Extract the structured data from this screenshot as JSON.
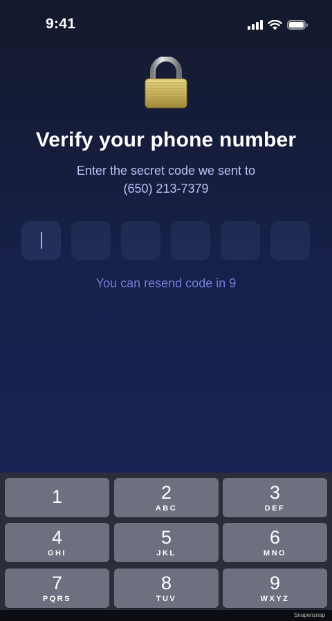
{
  "status_bar": {
    "time": "9:41",
    "icons": [
      "cellular-signal-icon",
      "wifi-icon",
      "battery-icon"
    ]
  },
  "header": {
    "icon": "padlock-icon",
    "title": "Verify your phone number",
    "subtitle_line1": "Enter the secret code we sent to",
    "phone_number": "(650) 213-7379"
  },
  "code_input": {
    "length": 6,
    "digits": [
      "",
      "",
      "",
      "",
      "",
      ""
    ],
    "active_index": 0
  },
  "resend": {
    "text": "You can resend code in 9"
  },
  "keypad": {
    "keys": [
      {
        "digit": "1",
        "letters": ""
      },
      {
        "digit": "2",
        "letters": "ABC"
      },
      {
        "digit": "3",
        "letters": "DEF"
      },
      {
        "digit": "4",
        "letters": "GHI"
      },
      {
        "digit": "5",
        "letters": "JKL"
      },
      {
        "digit": "6",
        "letters": "MNO"
      },
      {
        "digit": "7",
        "letters": "PQRS"
      },
      {
        "digit": "8",
        "letters": "TUV"
      },
      {
        "digit": "9",
        "letters": "WXYZ"
      }
    ]
  },
  "watermark": "Snapensnap",
  "colors": {
    "background_top": "#141a2c",
    "background_bottom": "#1a2458",
    "subtitle": "#b8c2f5",
    "resend_text": "#6f7fd6",
    "caret": "#8fb3ff",
    "key_background": "#6e7080",
    "keypad_background": "#2a2d3a"
  }
}
